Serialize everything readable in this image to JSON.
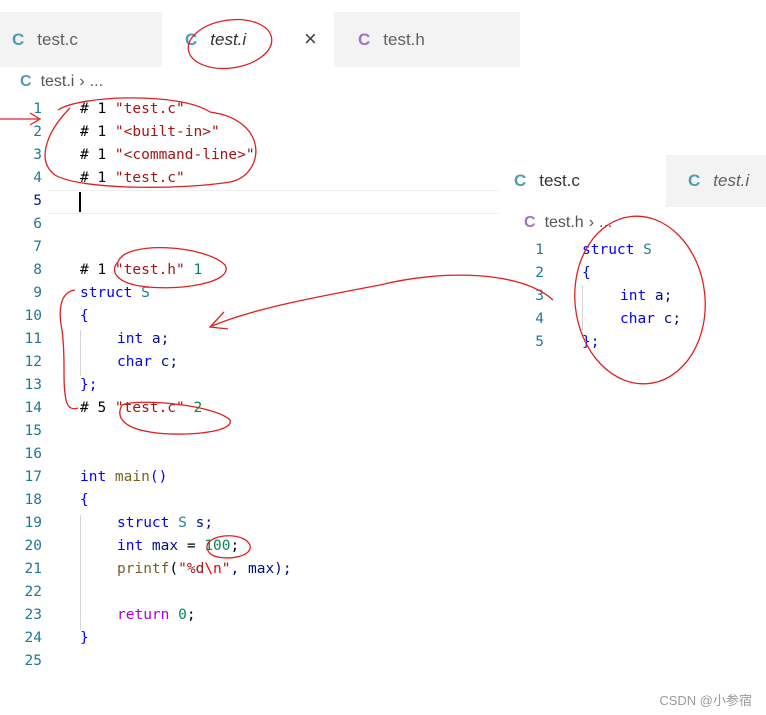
{
  "left_editor": {
    "tabs": [
      {
        "icon": "C",
        "label": "test.c"
      },
      {
        "icon": "C",
        "label": "test.i",
        "close": "×"
      },
      {
        "icon": "C",
        "label": "test.h"
      }
    ],
    "breadcrumb": {
      "icon": "C",
      "file": "test.i",
      "sep": "›",
      "rest": "..."
    },
    "line_numbers": [
      "1",
      "2",
      "3",
      "4",
      "5",
      "6",
      "7",
      "8",
      "9",
      "10",
      "11",
      "12",
      "13",
      "14",
      "15",
      "16",
      "17",
      "18",
      "19",
      "20",
      "21",
      "22",
      "23",
      "24",
      "25"
    ],
    "code": {
      "l1a": "# 1 ",
      "l1b": "\"test.c\"",
      "l2a": "# 1 ",
      "l2b": "\"<built-in>\"",
      "l3a": "# 1 ",
      "l3b": "\"<command-line>\"",
      "l4a": "# 1 ",
      "l4b": "\"test.c\"",
      "l8a": "# 1 ",
      "l8b": "\"test.h\"",
      "l8c": " 1",
      "l9a": "struct",
      "l9b": " S",
      "l10": "{",
      "l11a": "int",
      "l11b": " a;",
      "l12a": "char",
      "l12b": " c;",
      "l13": "};",
      "l14a": "# 5 ",
      "l14b": "\"test.c\"",
      "l14c": " 2",
      "l17a": "int",
      "l17b": " main",
      "l17c": "()",
      "l18": "{",
      "l19a": "struct",
      "l19b": " S",
      "l19c": " s;",
      "l20a": "int",
      "l20b": " max",
      "l20c": " = ",
      "l20d": "100",
      "l20e": ";",
      "l21a": "printf",
      "l21b": "(",
      "l21c": "\"%d",
      "l21d": "\\n",
      "l21e": "\"",
      "l21f": ", max);",
      "l23a": "return",
      "l23b": " 0",
      "l23c": ";",
      "l24": "}"
    }
  },
  "right_editor": {
    "tabs": [
      {
        "icon": "C",
        "label": "test.c"
      },
      {
        "icon": "C",
        "label": "test.i"
      }
    ],
    "breadcrumb": {
      "icon": "C",
      "file": "test.h",
      "sep": "›",
      "rest": "..."
    },
    "line_numbers": [
      "1",
      "2",
      "3",
      "4",
      "5"
    ],
    "code": {
      "l1a": "struct",
      "l1b": " S",
      "l2": "{",
      "l3a": "int",
      "l3b": " a;",
      "l4a": "char",
      "l4b": " c;",
      "l5": "};"
    }
  },
  "watermark": "CSDN @小参宿",
  "colors": {
    "annotation": "#e02020",
    "line_number": "#237893",
    "keyword": "#0000ff",
    "string": "#a31515",
    "type": "#267f99"
  }
}
